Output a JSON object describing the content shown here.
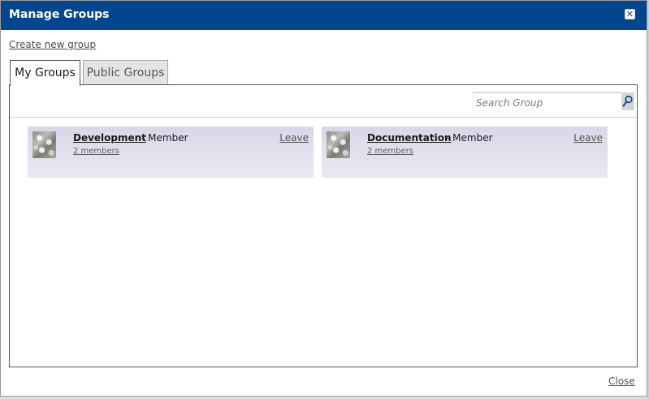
{
  "dialog": {
    "title": "Manage Groups",
    "close_icon": "close-icon",
    "create_link": "Create new group",
    "close_link": "Close"
  },
  "tabs": [
    {
      "label": "My Groups",
      "active": true
    },
    {
      "label": "Public Groups",
      "active": false
    }
  ],
  "search": {
    "placeholder": "Search Group",
    "button_icon": "search-icon"
  },
  "groups": [
    {
      "name": "Development",
      "role": " - Member",
      "members": "2 members",
      "action": "Leave"
    },
    {
      "name": "Documentation",
      "role": " - Member",
      "members": "2 members",
      "action": "Leave"
    }
  ],
  "colors": {
    "titlebar": "#02468f",
    "card": "#e0e0ee"
  }
}
